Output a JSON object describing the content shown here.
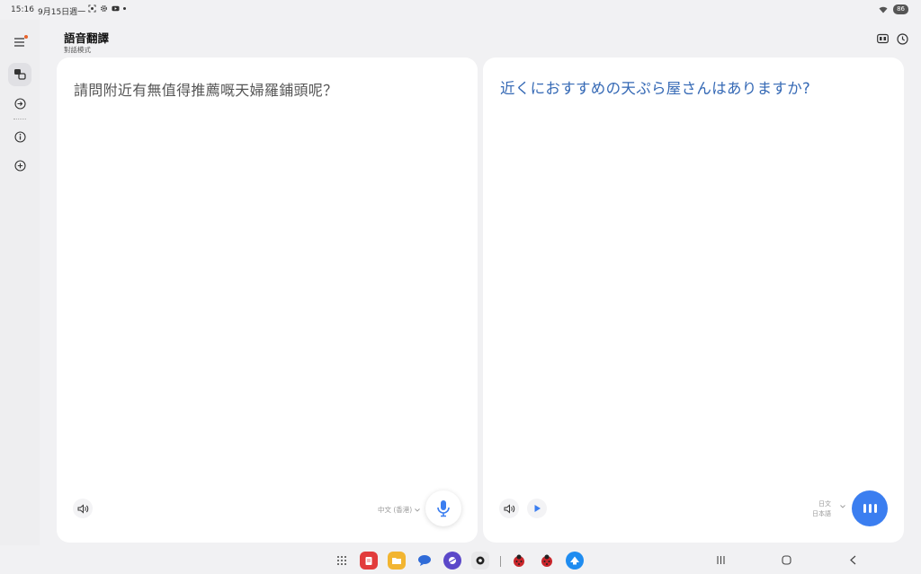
{
  "status_bar": {
    "time": "15:16",
    "date": "9月15日週一",
    "battery": "86"
  },
  "header": {
    "title": "語音翻譯",
    "subtitle": "對話模式"
  },
  "source": {
    "text": "請問附近有無值得推薦嘅天婦羅鋪頭呢？",
    "language": "中文 (香港)"
  },
  "target": {
    "text": "近くにおすすめの天ぷら屋さんはありますか?",
    "language_line1": "日文",
    "language_line2": "日本語"
  },
  "colors": {
    "accent": "#3b7ef0",
    "translation_text": "#3569b5",
    "notification_dot": "#e8632b"
  },
  "icons": {
    "sidebar": [
      "menu-icon",
      "conversation-icon",
      "export-icon",
      "info-icon",
      "add-icon"
    ],
    "header": [
      "split-screen-icon",
      "history-icon"
    ],
    "taskbar": [
      "app-drawer-icon",
      "notes-app-icon",
      "files-app-icon",
      "messages-app-icon",
      "browser-app-icon",
      "camera-app-icon",
      "ladybug-app-icon",
      "ladybug-app-icon-2",
      "store-app-icon"
    ]
  }
}
